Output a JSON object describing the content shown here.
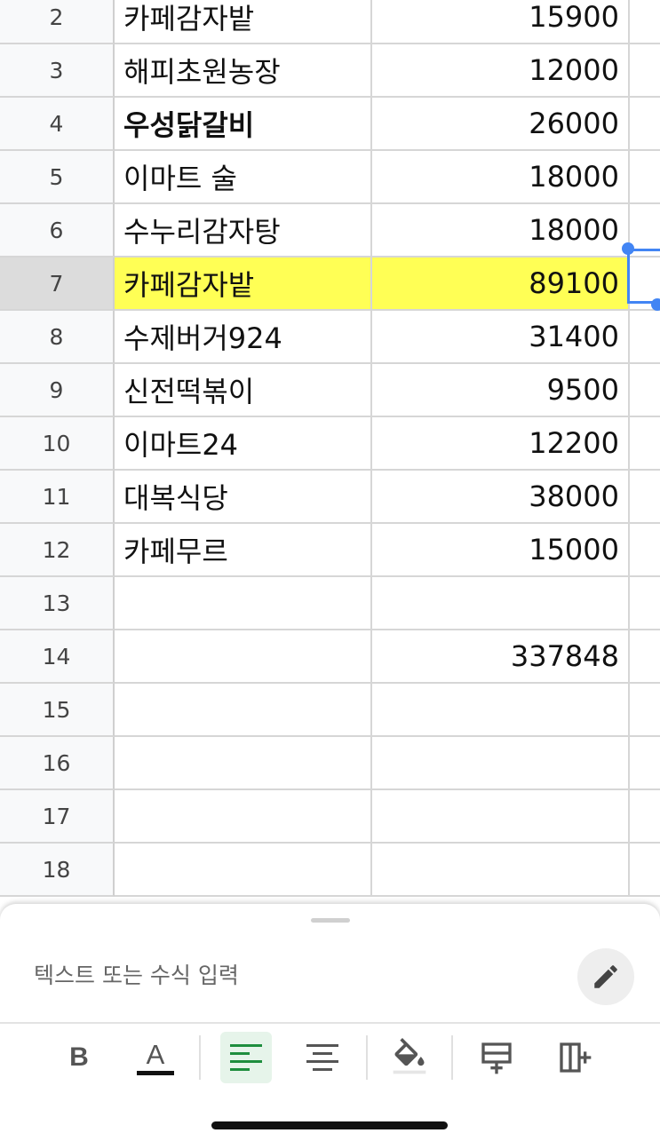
{
  "rows": [
    {
      "num": "2",
      "name": "카페감자밭",
      "amount": "15900"
    },
    {
      "num": "3",
      "name": "해피초원농장",
      "amount": "12000"
    },
    {
      "num": "4",
      "name": "우성닭갈비",
      "amount": "26000",
      "bold": true
    },
    {
      "num": "5",
      "name": "이마트 술",
      "amount": "18000"
    },
    {
      "num": "6",
      "name": "수누리감자탕",
      "amount": "18000"
    },
    {
      "num": "7",
      "name": "카페감자밭",
      "amount": "89100",
      "selected": true,
      "highlight": "#ffff55"
    },
    {
      "num": "8",
      "name": "수제버거924",
      "amount": "31400"
    },
    {
      "num": "9",
      "name": "신전떡볶이",
      "amount": "9500"
    },
    {
      "num": "10",
      "name": "이마트24",
      "amount": "12200"
    },
    {
      "num": "11",
      "name": "대복식당",
      "amount": "38000"
    },
    {
      "num": "12",
      "name": "카페무르",
      "amount": "15000"
    },
    {
      "num": "13",
      "name": "",
      "amount": ""
    },
    {
      "num": "14",
      "name": "",
      "amount": "337848"
    },
    {
      "num": "15",
      "name": "",
      "amount": ""
    },
    {
      "num": "16",
      "name": "",
      "amount": ""
    },
    {
      "num": "17",
      "name": "",
      "amount": ""
    },
    {
      "num": "18",
      "name": "",
      "amount": ""
    }
  ],
  "formula_bar": {
    "placeholder": "텍스트 또는 수식 입력",
    "edit_icon": "pencil-icon"
  },
  "toolbar": [
    {
      "icon": "bold-icon",
      "label": "B"
    },
    {
      "icon": "text-color-icon",
      "label": "A"
    },
    {
      "icon": "align-left-icon",
      "active": true
    },
    {
      "icon": "align-center-icon"
    },
    {
      "icon": "fill-color-icon"
    },
    {
      "icon": "insert-row-icon"
    },
    {
      "icon": "insert-column-icon"
    }
  ],
  "colors": {
    "accent": "#4285f4",
    "highlight": "#ffff55",
    "active_tool": "#1e8e3e"
  }
}
